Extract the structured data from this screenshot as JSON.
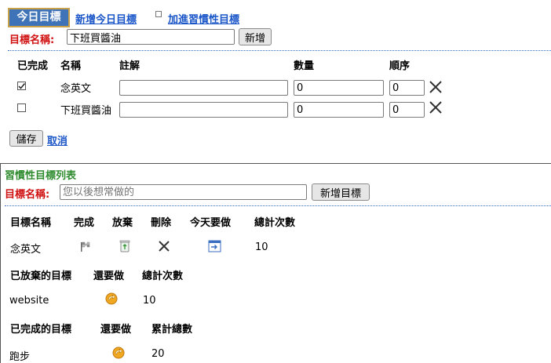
{
  "header": {
    "active_tab": "今日目標",
    "link_new_today": "新增今日目標",
    "link_add_habit": "加進習慣性目標"
  },
  "today_form": {
    "label": "目標名稱:",
    "input_value": "下班買醬油",
    "add_button": "新增"
  },
  "today_table": {
    "columns": [
      "已完成",
      "名稱",
      "註解",
      "數量",
      "順序"
    ],
    "rows": [
      {
        "done": true,
        "name": "念英文",
        "note": "",
        "quantity": "0",
        "order": "0"
      },
      {
        "done": false,
        "name": "下班買醬油",
        "note": "",
        "quantity": "0",
        "order": "0"
      }
    ],
    "save_button": "儲存",
    "cancel_link": "取消"
  },
  "habit_section": {
    "title": "習慣性目標列表",
    "label": "目標名稱:",
    "placeholder": "您以後想常做的",
    "add_button": "新增目標",
    "columns": [
      "目標名稱",
      "完成",
      "放棄",
      "刪除",
      "今天要做",
      "總計次數"
    ],
    "rows": [
      {
        "name": "念英文",
        "total": "10"
      }
    ]
  },
  "abandoned_section": {
    "columns": [
      "已放棄的目標",
      "還要做",
      "總計次數"
    ],
    "rows": [
      {
        "name": "website",
        "total": "10"
      }
    ]
  },
  "completed_section": {
    "columns": [
      "已完成的目標",
      "還要做",
      "累計總數"
    ],
    "rows": [
      {
        "name": "跑步",
        "total": "20"
      }
    ]
  },
  "icons": {
    "flag": "flag-icon",
    "recycle": "recycle-bin-icon",
    "delete": "close-icon",
    "today": "calendar-arrow-icon",
    "redo": "redo-arrow-icon"
  },
  "colors": {
    "tab_bg": "#3f73b7",
    "link": "#1a56c8",
    "label_red": "#d01010",
    "title_green": "#2e8b2e"
  }
}
